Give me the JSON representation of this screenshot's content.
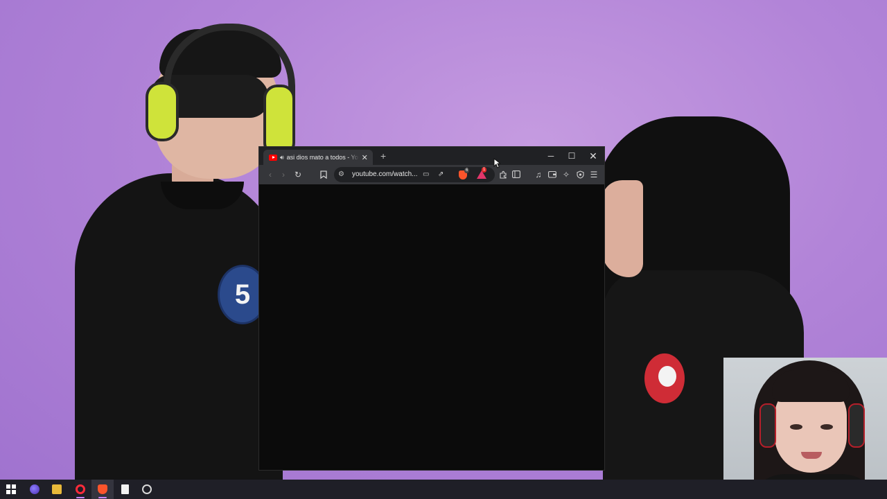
{
  "video_scene": {
    "contestant_number": "5"
  },
  "browser": {
    "tab": {
      "title": "asi dios mato a todos - YouTube",
      "audio_icon": "speaker-icon",
      "close_glyph": "✕"
    },
    "new_tab_glyph": "+",
    "window_controls": {
      "minimize": "─",
      "maximize": "☐",
      "close": "✕"
    },
    "toolbar": {
      "back_glyph": "‹",
      "forward_glyph": "›",
      "reload_glyph": "↻",
      "bookmark_glyph": "🔖",
      "url": "youtube.com/watch...",
      "shields_count": "6",
      "rewards_count": "1",
      "menu_glyph": "☰"
    }
  },
  "taskbar": {
    "apps": [
      "start",
      "app",
      "file-explorer",
      "opera",
      "brave",
      "notepad",
      "clock"
    ]
  },
  "colors": {
    "background": "#b98bd6",
    "browser_frame": "#35363a",
    "titlebar": "#202124",
    "youtube_red": "#ff0000",
    "brave_orange": "#fb542b",
    "taskbar": "#1f1f27",
    "taskbar_accent": "#c580ff"
  }
}
